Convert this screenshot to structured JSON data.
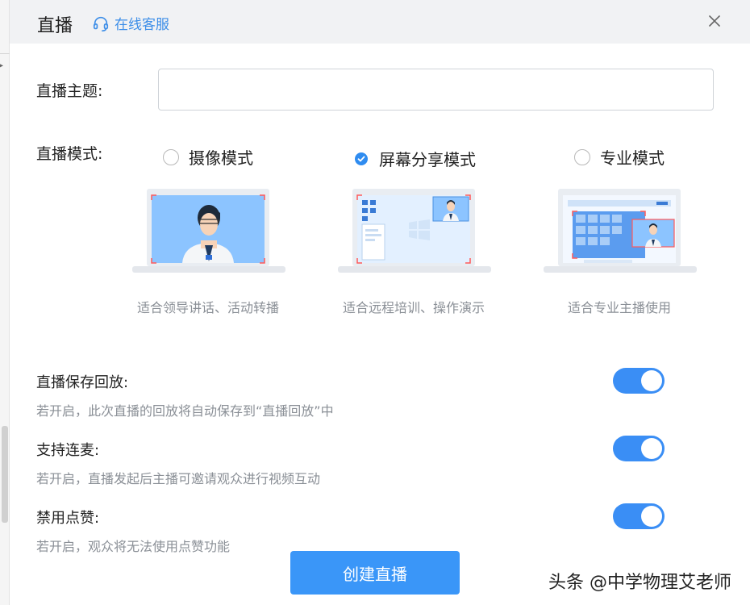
{
  "header": {
    "title": "直播",
    "service_label": "在线客服"
  },
  "topic": {
    "label": "直播主题:",
    "value": "",
    "placeholder": ""
  },
  "mode": {
    "label": "直播模式:",
    "selected": "屏幕分享模式",
    "options": [
      {
        "label": "摄像模式",
        "checked": false,
        "description": "适合领导讲话、活动转播"
      },
      {
        "label": "屏幕分享模式",
        "checked": true,
        "description": "适合远程培训、操作演示"
      },
      {
        "label": "专业模式",
        "checked": false,
        "description": "适合专业主播使用"
      }
    ]
  },
  "options": [
    {
      "title": "直播保存回放:",
      "description": "若开启，此次直播的回放将自动保存到“直播回放”中",
      "enabled": true
    },
    {
      "title": "支持连麦:",
      "description": "若开启，直播发起后主播可邀请观众进行视频互动",
      "enabled": true
    },
    {
      "title": "禁用点赞:",
      "description": "若开启，观众将无法使用点赞功能",
      "enabled": true
    }
  ],
  "create_button": "创建直播",
  "watermark": "头条 @中学物理艾老师",
  "colors": {
    "accent": "#3a8ef5",
    "header_bg": "#f1f2f4",
    "link": "#3d8ee8",
    "muted_text": "#8a8f96"
  },
  "icons": {
    "service": "headset-icon",
    "close": "close-icon",
    "radio_checked": "check-icon"
  }
}
